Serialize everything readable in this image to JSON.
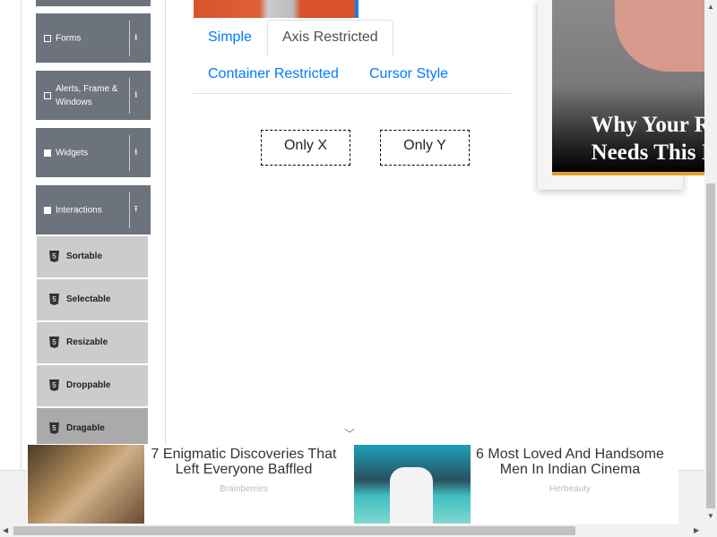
{
  "sidebar": {
    "groups": [
      {
        "label": "Forms",
        "icon": "file-icon"
      },
      {
        "label": "Alerts, Frame & Windows",
        "icon": "window-icon"
      },
      {
        "label": "Widgets",
        "icon": "grid-icon"
      },
      {
        "label": "Interactions",
        "icon": "interaction-icon"
      }
    ],
    "interactions": [
      {
        "label": "Sortable"
      },
      {
        "label": "Selectable"
      },
      {
        "label": "Resizable"
      },
      {
        "label": "Droppable"
      },
      {
        "label": "Dragable",
        "active": true
      }
    ],
    "h5_glyph": "5"
  },
  "tabs": [
    {
      "label": "Simple"
    },
    {
      "label": "Axis Restricted",
      "active": true
    },
    {
      "label": "Container Restricted"
    },
    {
      "label": "Cursor Style"
    }
  ],
  "draggables": {
    "x": "Only X",
    "y": "Only Y"
  },
  "side_ad": {
    "line1": "Why Your R",
    "line2": "Needs This I"
  },
  "bottom_ads": [
    {
      "title": "7 Enigmatic Discoveries That Left Everyone Baffled",
      "source": "Brainberries"
    },
    {
      "title": "6 Most Loved And Handsome Men In Indian Cinema",
      "source": "Herbeauty"
    }
  ],
  "colors": {
    "sidebar": "#6c737d",
    "link": "#007bff",
    "ad_bar": "#e0a030"
  }
}
